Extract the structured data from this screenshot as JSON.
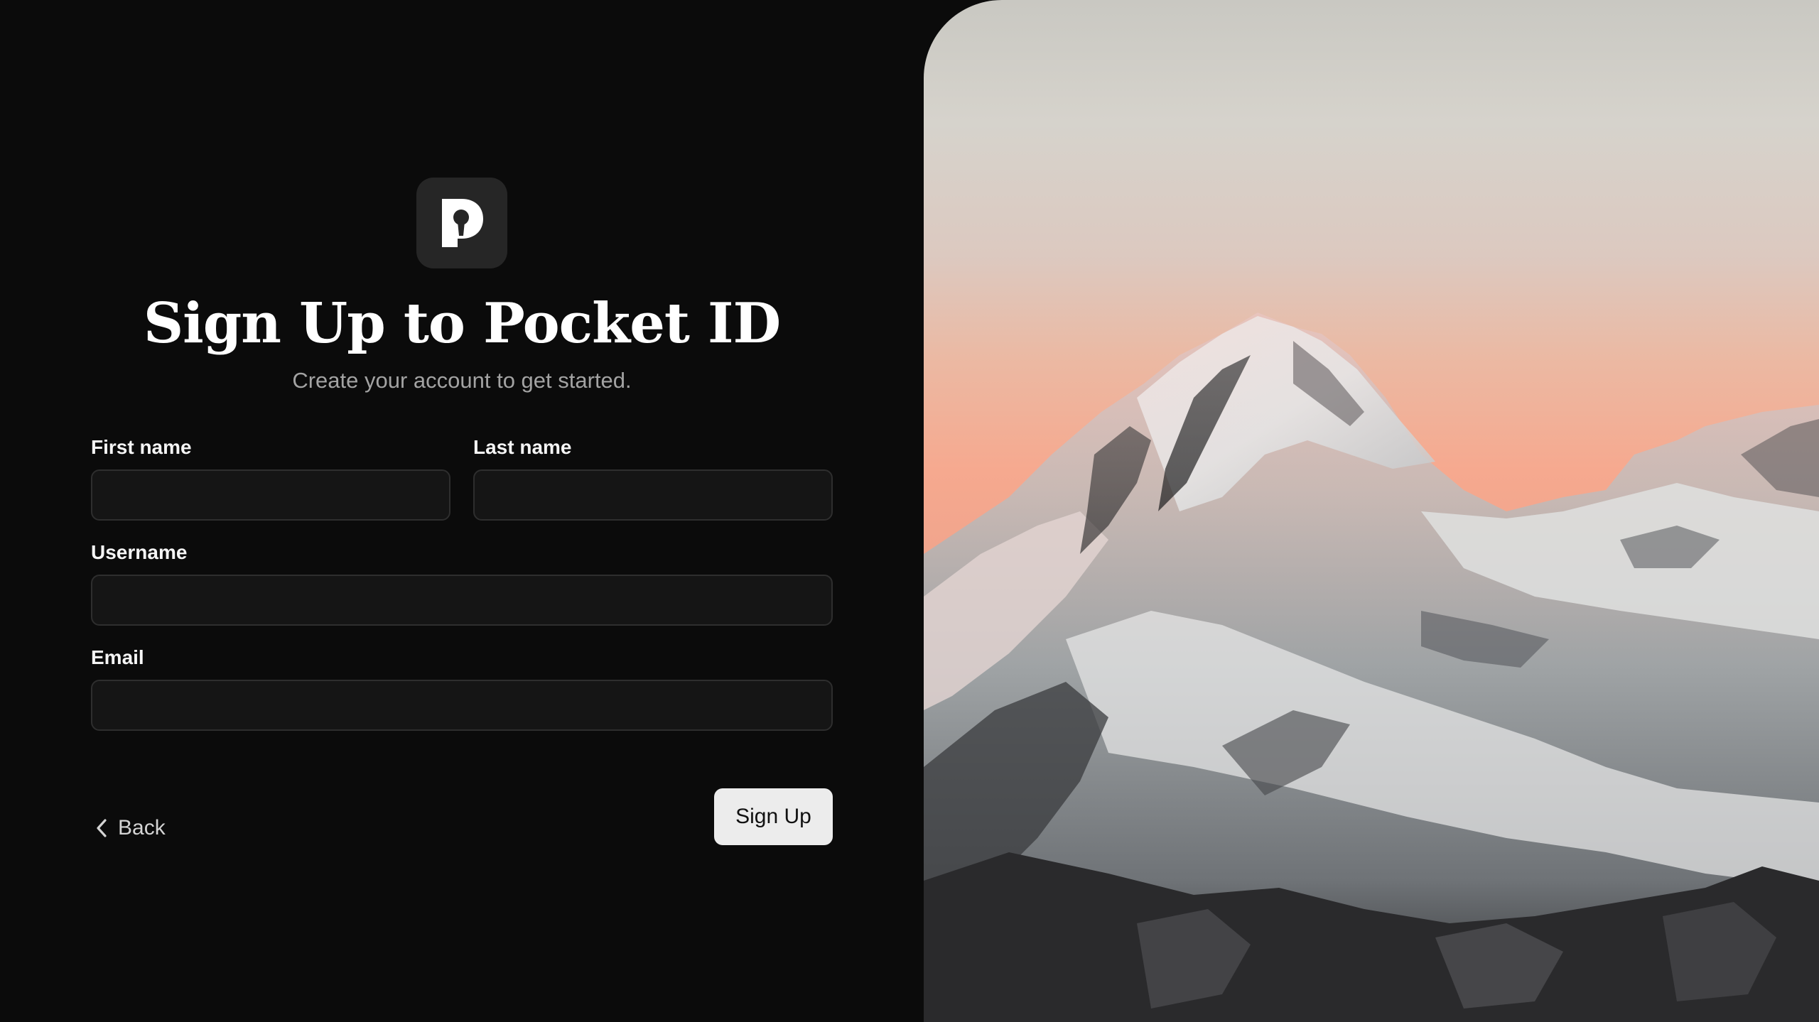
{
  "brand": {
    "logo_icon": "pocket-id-logo-icon",
    "logo_letter": "P"
  },
  "header": {
    "title": "Sign Up to Pocket ID",
    "subtitle": "Create your account to get started."
  },
  "form": {
    "first_name": {
      "label": "First name",
      "value": "",
      "placeholder": ""
    },
    "last_name": {
      "label": "Last name",
      "value": "",
      "placeholder": ""
    },
    "username": {
      "label": "Username",
      "value": "",
      "placeholder": ""
    },
    "email": {
      "label": "Email",
      "value": "",
      "placeholder": ""
    }
  },
  "actions": {
    "back_label": "Back",
    "back_icon": "chevron-left-icon",
    "submit_label": "Sign Up"
  },
  "colors": {
    "background": "#0b0b0b",
    "input_background": "#151515",
    "input_border": "#2e2e2e",
    "button_background": "#ececec",
    "subtitle": "#a3a3a3"
  },
  "hero_image": {
    "description_icon": "mountain-photo"
  }
}
